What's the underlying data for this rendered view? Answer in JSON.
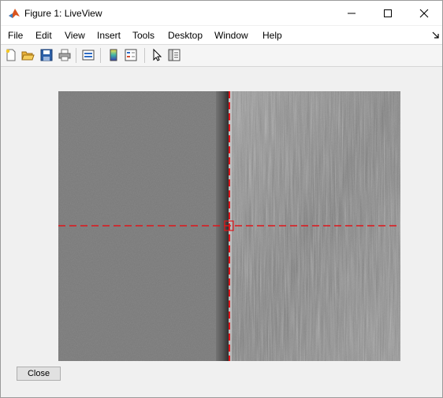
{
  "window": {
    "title": "Figure 1: LiveView"
  },
  "menu": {
    "items": [
      "File",
      "Edit",
      "View",
      "Insert",
      "Tools",
      "Desktop",
      "Window",
      "Help"
    ]
  },
  "toolbar": {
    "icons": [
      "new-figure-icon",
      "open-file-icon",
      "save-icon",
      "print-icon",
      "link-plot-icon",
      "colorbar-icon",
      "legend-icon",
      "pointer-icon",
      "property-inspector-icon"
    ]
  },
  "image": {
    "crosshair_color": "#e0151a",
    "left_region_color": "#7a7a7a",
    "right_region_color": "#8c8c8c"
  },
  "controls": {
    "close_label": "Close"
  }
}
